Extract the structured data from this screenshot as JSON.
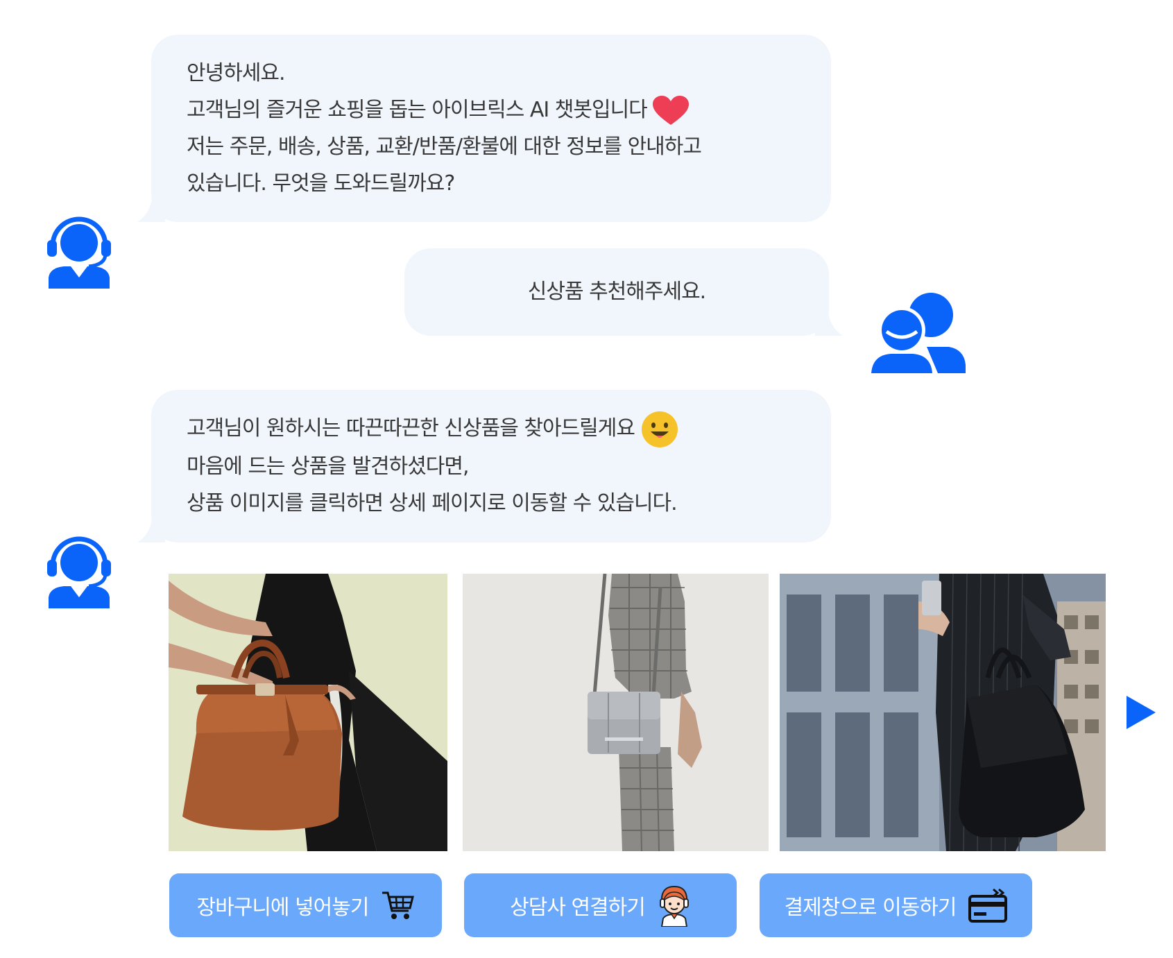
{
  "colors": {
    "accent": "#0a64fa",
    "bubble_bg": "#f1f6fd",
    "button_bg": "#6aa8fc",
    "heart": "#ed3e55",
    "emoji": "#f6c22a"
  },
  "messages": {
    "bot_greeting": {
      "lines": [
        "안녕하세요.",
        "고객님의 즐거운 쇼핑을 돕는 아이브릭스 AI 챗봇입니다",
        "저는 주문, 배송, 상품, 교환/반품/환불에 대한 정보를 안내하고",
        "있습니다. 무엇을 도와드릴까요?"
      ],
      "icon": "heart-icon"
    },
    "user_request": {
      "text": "신상품 추천해주세요."
    },
    "bot_reply": {
      "lines": [
        "고객님이 원하시는 따끈따끈한 신상품을 찾아드릴게요",
        "마음에 드는 상품을 발견하셨다면,",
        "상품 이미지를 클릭하면 상세 페이지로 이동할 수 있습니다."
      ],
      "icon": "smiley-emoji-icon"
    }
  },
  "icons": {
    "agent_avatar": "headset-agent-icon",
    "user_avatar": "users-icon",
    "next": "play-arrow-icon"
  },
  "products": [
    {
      "icon": "brown-handbag-photo"
    },
    {
      "icon": "grey-crossbody-bag-photo"
    },
    {
      "icon": "black-tote-bag-photo"
    }
  ],
  "actions": {
    "cart": {
      "label": "장바구니에 넣어놓기",
      "icon": "shopping-cart-icon"
    },
    "agent": {
      "label": "상담사 연결하기",
      "icon": "counselor-icon"
    },
    "pay": {
      "label": "결제창으로 이동하기",
      "icon": "credit-card-icon"
    }
  }
}
